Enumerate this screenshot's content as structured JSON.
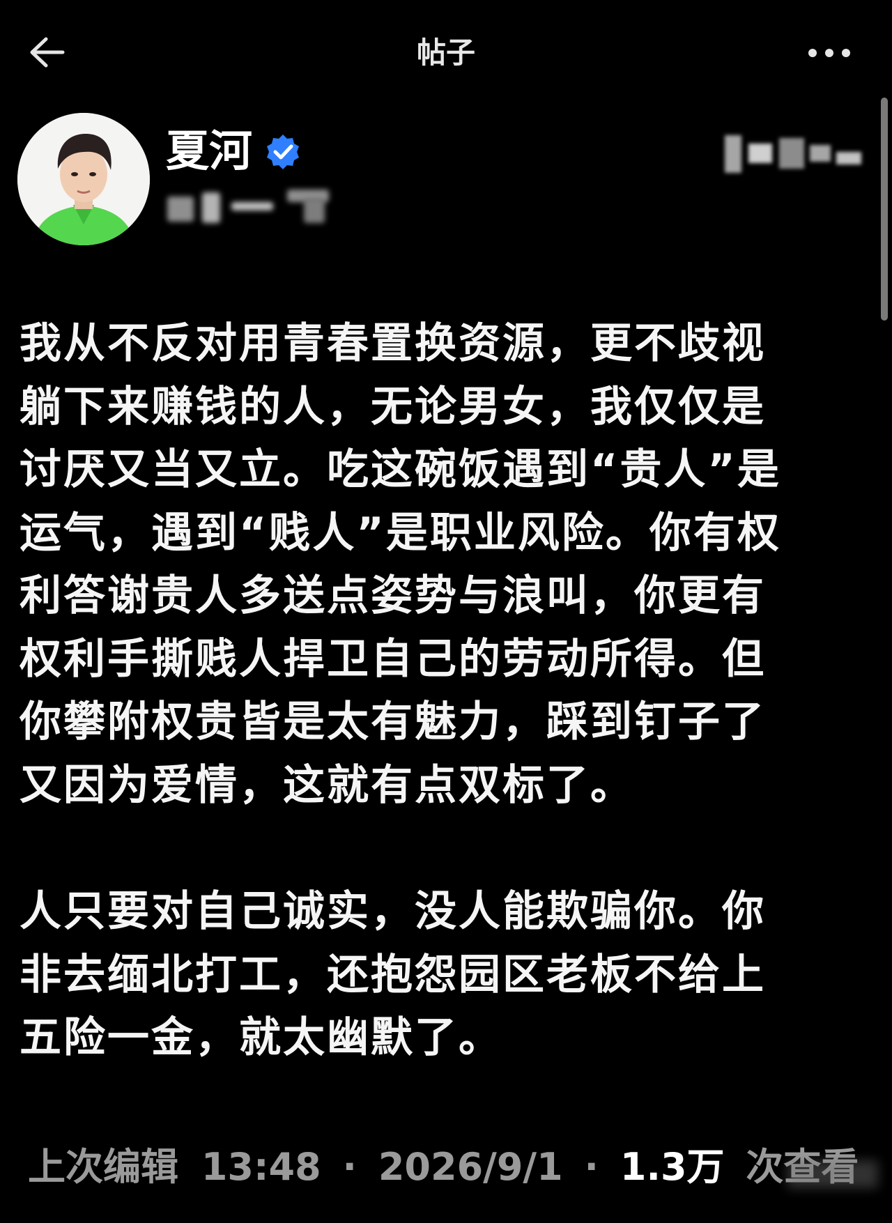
{
  "header": {
    "title": "帖子",
    "back_icon": "arrow-left-icon",
    "more_icon": "more-horizontal-icon"
  },
  "author": {
    "name": "夏河",
    "verified_icon": "verified-badge-icon",
    "verified_color": "#2f7fff",
    "avatar_shirt_color": "#55d64f"
  },
  "post": {
    "paragraphs": [
      "我从不反对用青春置换资源，更不歧视\n躺下来赚钱的人，无论男女，我仅仅是\n讨厌又当又立。吃这碗饭遇到“贵人”是\n运气，遇到“贱人”是职业风险。你有权\n利答谢贵人多送点姿势与浪叫，你更有\n权利手撕贱人捍卫自己的劳动所得。但\n你攀附权贵皆是太有魅力，踩到钉子了\n又因为爱情，这就有点双标了。",
      "人只要对自己诚实，没人能欺骗你。你\n非去缅北打工，还抱怨园区老板不给上\n五险一金，就太幽默了。"
    ]
  },
  "meta": {
    "edited_label": "上次编辑",
    "time": "13:48",
    "separator": "·",
    "date": "2026/9/1",
    "views": "1.3万",
    "views_suffix": "次查看"
  },
  "colors": {
    "background": "#000000",
    "text": "#f5f5f5",
    "muted": "#9a9a9a"
  }
}
